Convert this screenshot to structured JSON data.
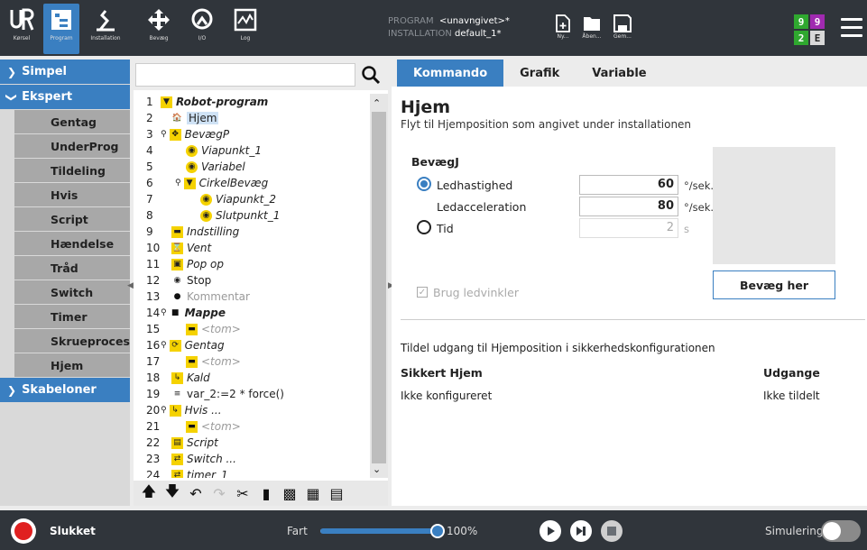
{
  "topbar": {
    "nav": [
      {
        "label": "Kørsel",
        "icon": "ur-logo-icon"
      },
      {
        "label": "Program",
        "icon": "program-icon",
        "active": true
      },
      {
        "label": "Installation",
        "icon": "installation-icon"
      },
      {
        "label": "Bevæg",
        "icon": "move-icon"
      },
      {
        "label": "I/O",
        "icon": "io-icon"
      },
      {
        "label": "Log",
        "icon": "log-icon"
      }
    ],
    "program_key": "PROGRAM",
    "program_value": "<unavngivet>*",
    "installation_key": "INSTALLATION",
    "installation_value": "default_1*",
    "file_buttons": [
      {
        "label": "Ny...",
        "icon": "new-file-icon"
      },
      {
        "label": "Åben...",
        "icon": "open-folder-icon"
      },
      {
        "label": "Gem...",
        "icon": "save-icon"
      }
    ],
    "status": [
      "9",
      "9",
      "2",
      "E"
    ],
    "status_colors": [
      "#2fa82f",
      "#a02ab0",
      "#2fa82f",
      "#d8d8d8"
    ]
  },
  "sidebar": {
    "simpel": "Simpel",
    "ekspert": "Ekspert",
    "items": [
      "Gentag",
      "UnderProg",
      "Tildeling",
      "Hvis",
      "Script",
      "Hændelse",
      "Tråd",
      "Switch",
      "Timer",
      "Skrueproces",
      "Hjem"
    ],
    "skabeloner": "Skabeloner"
  },
  "tree": {
    "rows": [
      {
        "n": "1",
        "text": "Robot-program",
        "icon": "triangle-icon"
      },
      {
        "n": "2",
        "text": "Hjem",
        "icon": "home-icon"
      },
      {
        "n": "3",
        "text": "BevægP",
        "icon": "move-icon"
      },
      {
        "n": "4",
        "text": "Viapunkt_1",
        "icon": "waypoint-icon"
      },
      {
        "n": "5",
        "text": "Variabel",
        "icon": "waypoint-icon"
      },
      {
        "n": "6",
        "text": "CirkelBevæg",
        "icon": "triangle-icon"
      },
      {
        "n": "7",
        "text": "Viapunkt_2",
        "icon": "waypoint-icon"
      },
      {
        "n": "8",
        "text": "Slutpunkt_1",
        "icon": "waypoint-icon"
      },
      {
        "n": "9",
        "text": "Indstilling",
        "icon": "set-icon"
      },
      {
        "n": "10",
        "text": "Vent",
        "icon": "hourglass-icon"
      },
      {
        "n": "11",
        "text": "Pop op",
        "icon": "popup-icon"
      },
      {
        "n": "12",
        "text": "Stop",
        "icon": "stop-icon"
      },
      {
        "n": "13",
        "text": "Kommentar",
        "icon": "comment-icon"
      },
      {
        "n": "14",
        "text": "Mappe",
        "icon": "folder-icon"
      },
      {
        "n": "15",
        "text": "<tom>",
        "icon": "set-icon"
      },
      {
        "n": "16",
        "text": "Gentag",
        "icon": "loop-icon"
      },
      {
        "n": "17",
        "text": "<tom>",
        "icon": "set-icon"
      },
      {
        "n": "18",
        "text": "Kald",
        "icon": "call-icon"
      },
      {
        "n": "19",
        "text": "var_2:=2 * force()",
        "icon": "assign-icon"
      },
      {
        "n": "20",
        "text": "Hvis ...",
        "icon": "if-icon"
      },
      {
        "n": "21",
        "text": "<tom>",
        "icon": "set-icon"
      },
      {
        "n": "22",
        "text": "Script",
        "icon": "script-icon"
      },
      {
        "n": "23",
        "text": "Switch ...",
        "icon": "switch-icon"
      },
      {
        "n": "24",
        "text": "timer_1",
        "icon": "timer-icon"
      }
    ]
  },
  "tabs": [
    "Kommando",
    "Grafik",
    "Variable"
  ],
  "main": {
    "title": "Hjem",
    "subtitle": "Flyt til Hjemposition som angivet under installationen",
    "group_title": "BevægJ",
    "speed_label": "Ledhastighed",
    "speed_value": "60",
    "speed_unit": "°/sek.",
    "accel_label": "Ledacceleration",
    "accel_value": "80",
    "accel_unit": "°/sek.²",
    "time_label": "Tid",
    "time_value": "2",
    "time_unit": "s",
    "move_button": "Bevæg her",
    "checkbox_label": "Brug ledvinkler",
    "safety_text": "Tildel udgang til Hjemposition i sikkerhedskonfigurationen",
    "col_safe_home": "Sikkert Hjem",
    "col_outputs": "Udgange",
    "safe_home_value": "Ikke konfigureret",
    "outputs_value": "Ikke tildelt"
  },
  "footer": {
    "power_label": "Slukket",
    "speed_label": "Fart",
    "speed_value": "100%",
    "speed_fraction": 1.0,
    "sim_label": "Simulering"
  }
}
